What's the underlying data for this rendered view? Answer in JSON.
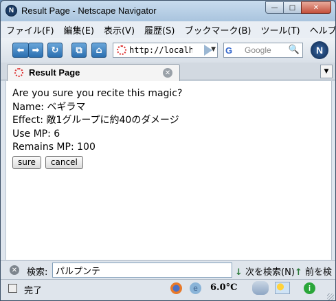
{
  "window": {
    "title": "Result Page - Netscape Navigator",
    "app_logo": "N",
    "controls": {
      "minimize": "—",
      "maximize": "□",
      "close": "✕"
    }
  },
  "menu": {
    "items": [
      "ファイル(F)",
      "編集(E)",
      "表示(V)",
      "履歴(S)",
      "ブックマーク(B)",
      "ツール(T)",
      "ヘルプ"
    ]
  },
  "toolbar": {
    "back_icon": "back-arrow-icon",
    "forward_icon": "forward-arrow-icon",
    "url": "http://localhost",
    "search_placeholder": "Google",
    "search_engine": "G"
  },
  "tab": {
    "label": "Result Page"
  },
  "page": {
    "lines": [
      "Are you sure you recite this magic?",
      "Name: ベギラマ",
      "Effect: 敵1グループに約40のダメージ",
      "Use MP: 6",
      "Remains MP: 100"
    ],
    "buttons": {
      "sure": "sure",
      "cancel": "cancel"
    }
  },
  "findbar": {
    "label": "検索:",
    "value": "パルプンテ",
    "next_label": "次を検索(N)",
    "prev_label": "前を検"
  },
  "status": {
    "text": "完了",
    "temperature": "6.0°C"
  },
  "colors": {
    "nav_button": "#2b6fb0",
    "status_ok": "#2aa63a"
  }
}
